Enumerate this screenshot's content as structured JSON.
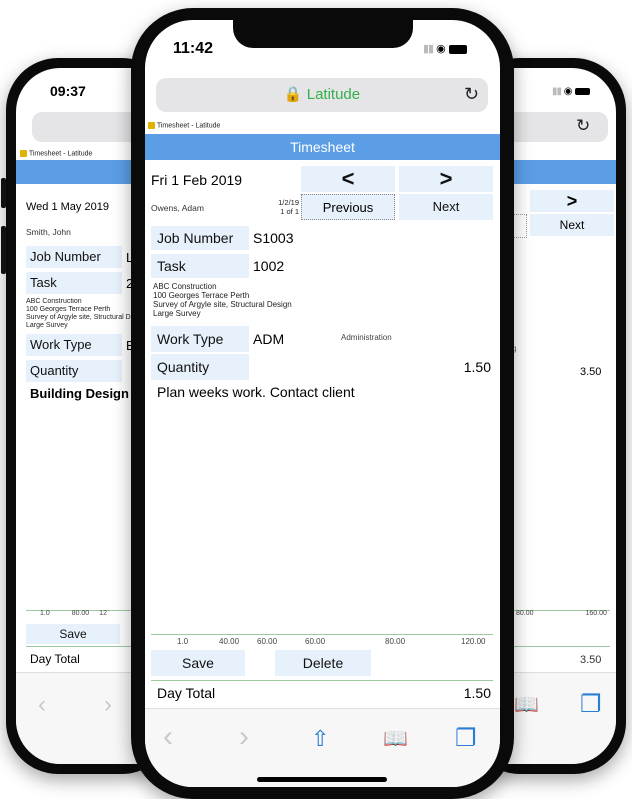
{
  "left_phone": {
    "time": "09:37",
    "app_tab": "Timesheet - Latitude",
    "date": "Wed 1 May 2019",
    "employee": "Smith, John",
    "job_number_label": "Job Number",
    "job_number_partial": "L",
    "task_label": "Task",
    "task_partial": "2(",
    "address_lines": [
      "ABC Construction",
      "100 Georges Terrace Perth",
      "Survey of Argyle site, Structural Design",
      "Large Survey"
    ],
    "work_type_label": "Work Type",
    "work_type_partial": "B",
    "quantity_label": "Quantity",
    "description": "Building Design",
    "scale_labels": [
      "1.0",
      "80.00",
      "12"
    ],
    "save_label": "Save",
    "day_total_label": "Day Total"
  },
  "right_phone": {
    "next_glyph": ">",
    "next_label": "Next",
    "partial_g": "g",
    "quantity_value": "3.50",
    "scale_labels": [
      "80.00",
      "160.00"
    ],
    "day_total_value": "3.50"
  },
  "center_phone": {
    "time": "11:42",
    "url": "Latitude",
    "app_tab": "Timesheet - Latitude",
    "header": "Timesheet",
    "date": "Fri 1 Feb 2019",
    "employee": "Owens, Adam",
    "record_date": "1/2/19",
    "record_pos": "1 of 1",
    "prev_glyph": "<",
    "next_glyph": ">",
    "prev_label": "Previous",
    "next_label": "Next",
    "job_number_label": "Job Number",
    "job_number_value": "S1003",
    "task_label": "Task",
    "task_value": "1002",
    "address_lines": [
      "ABC Construction",
      "100 Georges Terrace Perth",
      "Survey of Argyle site, Structural Design",
      "Large Survey"
    ],
    "work_type_label": "Work Type",
    "work_type_value": "ADM",
    "work_type_desc": "Administration",
    "quantity_label": "Quantity",
    "quantity_value": "1.50",
    "description": "Plan weeks work. Contact client",
    "scale_labels": [
      "1.0",
      "40.00",
      "60.00",
      "60.00",
      "80.00",
      "120.00"
    ],
    "save_label": "Save",
    "delete_label": "Delete",
    "day_total_label": "Day Total",
    "day_total_value": "1.50"
  },
  "colors": {
    "header_blue": "#5b9ee6",
    "cell_blue": "#e7f1fb",
    "lock_green": "#35b04a",
    "ios_blue": "#2a7cd6",
    "divider_green": "#9cc9a0"
  },
  "icons": [
    "lock-icon",
    "reload-icon",
    "back-icon",
    "forward-icon",
    "share-icon",
    "bookmarks-icon",
    "tabs-icon",
    "signal-icon",
    "wifi-icon",
    "battery-icon",
    "app-logo-icon"
  ]
}
